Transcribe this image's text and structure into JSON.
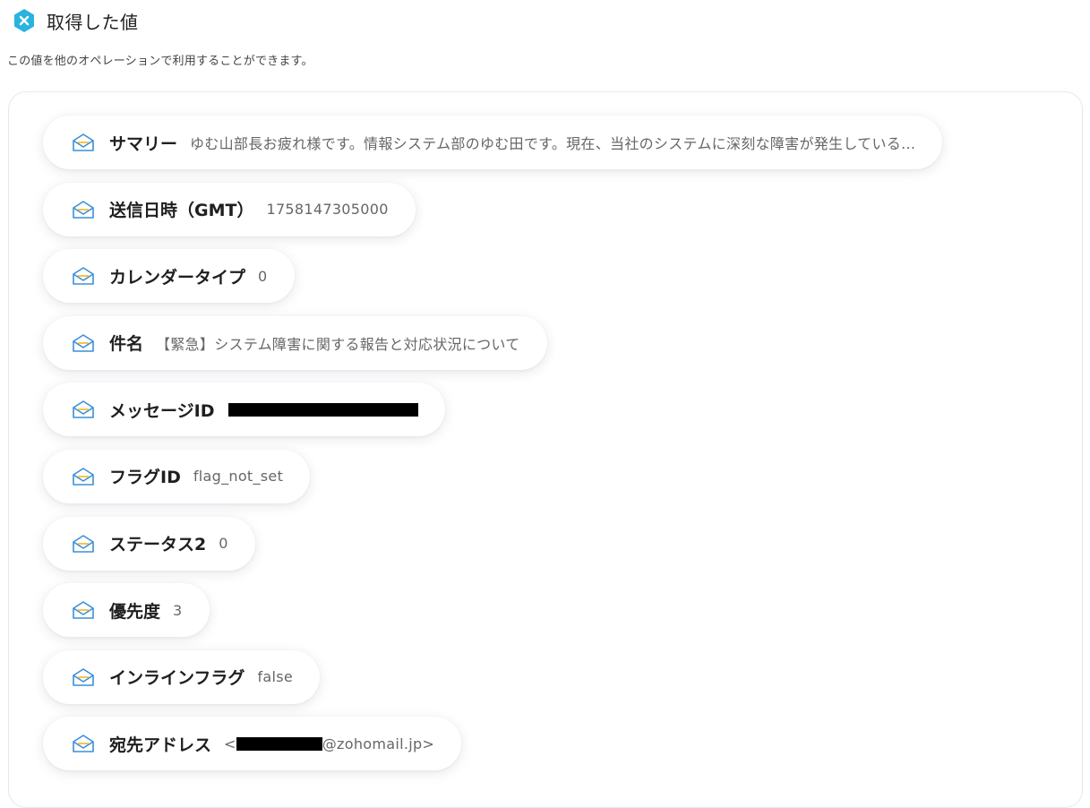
{
  "header": {
    "title": "取得した値",
    "description": "この値を他のオペレーションで利用することができます。",
    "icon": "zoho-mail-logo-icon",
    "icon_color": "#2bb3e0"
  },
  "items": [
    {
      "label": "サマリー",
      "value": "ゆむ山部長お疲れ様です。情報システム部のゆむ田です。現在、当社のシステムに深刻な障害が発生している..."
    },
    {
      "label": "送信日時（GMT）",
      "value": "1758147305000"
    },
    {
      "label": "カレンダータイプ",
      "value": "0"
    },
    {
      "label": "件名",
      "value": "【緊急】システム障害に関する報告と対応状況について"
    },
    {
      "label": "メッセージID",
      "value": ""
    },
    {
      "label": "フラグID",
      "value": "flag_not_set"
    },
    {
      "label": "ステータス2",
      "value": "0"
    },
    {
      "label": "優先度",
      "value": "3"
    },
    {
      "label": "インラインフラグ",
      "value": "false"
    },
    {
      "label": "宛先アドレス",
      "value_prefix": "<",
      "value_suffix": "@zohomail.jp>"
    }
  ],
  "colors": {
    "mail_icon_stroke": "#3a8fd8",
    "mail_icon_accent": "#f2b824"
  }
}
